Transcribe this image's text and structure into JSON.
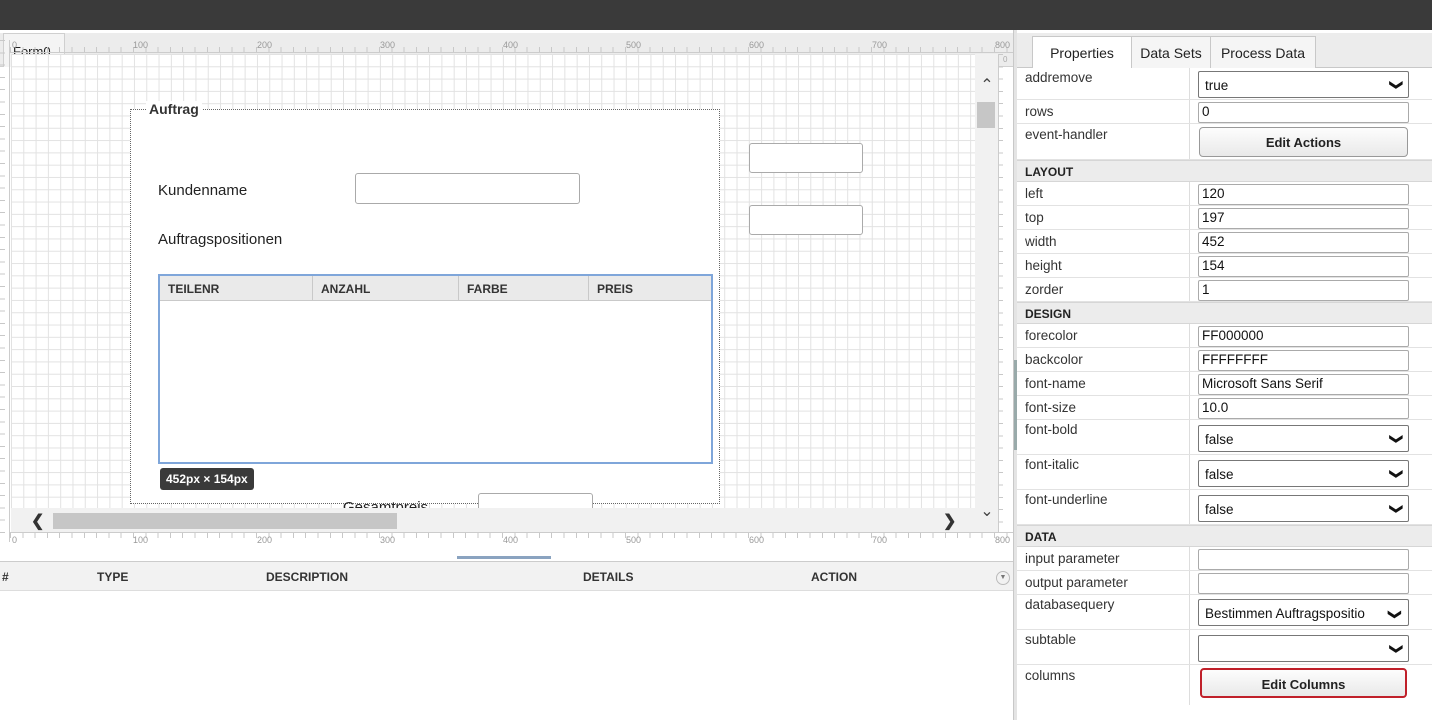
{
  "designer": {
    "tab_label": "Form0",
    "ruler_labels": [
      "0",
      "100",
      "200",
      "300",
      "400",
      "500",
      "600",
      "700",
      "800"
    ],
    "form": {
      "group_title": "Auftrag",
      "kundenname_label": "Kundenname",
      "positions_label": "Auftragspositionen",
      "grid_columns": [
        "TEILENR",
        "ANZAHL",
        "FARBE",
        "PREIS"
      ],
      "size_badge": "452px × 154px",
      "gesamtpreis_label": "Gesamtpreis"
    }
  },
  "messages": {
    "columns": [
      "#",
      "TYPE",
      "DESCRIPTION",
      "DETAILS",
      "ACTION"
    ]
  },
  "panel": {
    "tabs": [
      "Properties",
      "Data Sets",
      "Process Data"
    ],
    "active_tab": "Properties",
    "props_top": [
      {
        "name": "addremove",
        "kind": "select",
        "value": "true"
      },
      {
        "name": "rows",
        "kind": "input",
        "value": "0"
      },
      {
        "name": "event-handler",
        "kind": "button",
        "value": "Edit Actions"
      }
    ],
    "sections": {
      "layout": "LAYOUT",
      "design": "DESIGN",
      "data": "DATA"
    },
    "layout_props": [
      {
        "name": "left",
        "value": "120"
      },
      {
        "name": "top",
        "value": "197"
      },
      {
        "name": "width",
        "value": "452"
      },
      {
        "name": "height",
        "value": "154"
      },
      {
        "name": "zorder",
        "value": "1"
      }
    ],
    "design_props": [
      {
        "name": "forecolor",
        "value": "FF000000"
      },
      {
        "name": "backcolor",
        "value": "FFFFFFFF"
      },
      {
        "name": "font-name",
        "value": "Microsoft Sans Serif"
      },
      {
        "name": "font-size",
        "value": "10.0"
      }
    ],
    "design_selects": [
      {
        "name": "font-bold",
        "value": "false"
      },
      {
        "name": "font-italic",
        "value": "false"
      },
      {
        "name": "font-underline",
        "value": "false"
      }
    ],
    "data_props": {
      "input_parameter": {
        "name": "input parameter",
        "value": ""
      },
      "output_parameter": {
        "name": "output parameter",
        "value": ""
      },
      "databasequery": {
        "name": "databasequery",
        "value": "Bestimmen Auftragspositio"
      },
      "subtable": {
        "name": "subtable",
        "value": ""
      },
      "columns": {
        "name": "columns",
        "value": "Edit Columns"
      }
    }
  },
  "colors": {
    "topbar": "#3a3a3a",
    "grid_selected_border": "#7fa6da",
    "edit_columns_border": "#c0202a"
  },
  "icons": {
    "scroll_up": "chevron-up-icon",
    "scroll_down": "chevron-down-icon",
    "scroll_left": "chevron-left-icon",
    "scroll_right": "chevron-right-icon",
    "select_arrow": "chevron-down-icon"
  }
}
